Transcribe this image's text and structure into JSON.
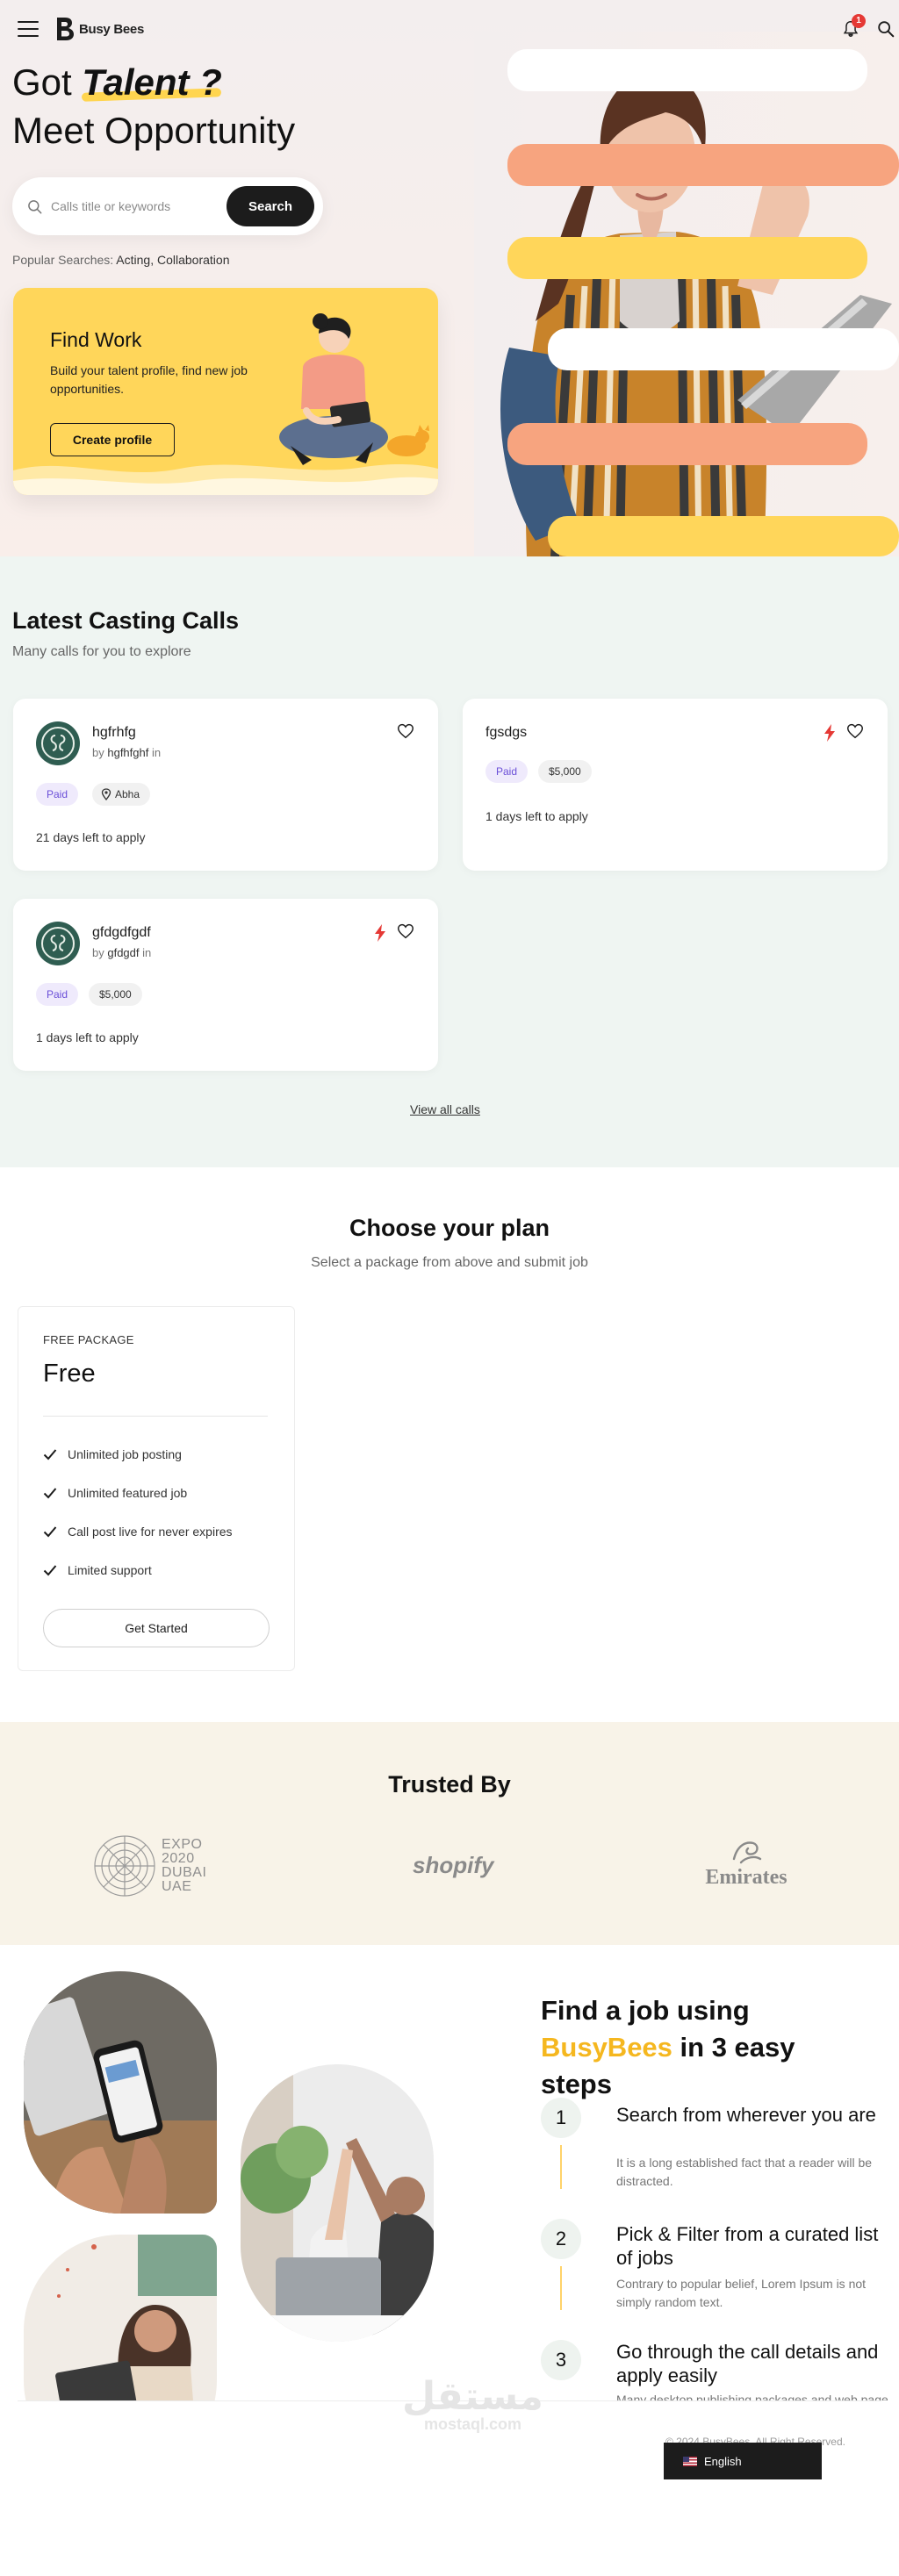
{
  "brand": {
    "name": "Busy Bees"
  },
  "header": {
    "notification_count": "1"
  },
  "hero": {
    "title_prefix": "Got ",
    "title_highlight": "Talent ?",
    "title_line2": "Meet Opportunity",
    "search_placeholder": "Calls title or keywords",
    "search_button": "Search",
    "popular_label": "Popular Searches: ",
    "popular_tags": "Acting, Collaboration"
  },
  "find_work": {
    "title": "Find Work",
    "description": "Build your talent profile, find new job opportunities.",
    "button": "Create profile"
  },
  "casting": {
    "title": "Latest Casting Calls",
    "subtitle": "Many calls for you to explore",
    "view_all": "View all calls",
    "cards": [
      {
        "title": "hgfrhfg",
        "by_prefix": "by",
        "by_name": "hgfhfghf",
        "by_suffix": "in",
        "tag1": "Paid",
        "tag2": "Abha",
        "deadline_num": "21",
        "deadline_text": " days left to apply"
      },
      {
        "title": "fgsdgs",
        "tag1": "Paid",
        "tag2": "$5,000",
        "deadline_num": "1",
        "deadline_text": " days left to apply"
      },
      {
        "title": "gfdgdfgdf",
        "by_prefix": "by",
        "by_name": "gfdgdf",
        "by_suffix": "in",
        "tag1": "Paid",
        "tag2": "$5,000",
        "deadline_num": "1",
        "deadline_text": " days left to apply"
      }
    ]
  },
  "plans": {
    "title": "Choose your plan",
    "subtitle": "Select a package from above and submit job",
    "package": {
      "tag": "FREE PACKAGE",
      "name": "Free",
      "features": [
        "Unlimited job posting",
        "Unlimited featured job",
        "Call post live for never expires",
        "Limited support"
      ],
      "button": "Get Started"
    }
  },
  "trusted": {
    "title": "Trusted By",
    "logos": {
      "expo_line1": "EXPO",
      "expo_line2": "2020",
      "expo_line3": "DUBAI",
      "expo_line4": "UAE",
      "shopify": "shopify",
      "emirates": "Emirates"
    }
  },
  "steps": {
    "title_line1": "Find a job using",
    "title_brand": "BusyBees",
    "title_line2_rest": " in 3 easy",
    "title_line3": "steps",
    "items": [
      {
        "num": "1",
        "head": "Search from  wherever  you are",
        "desc": "It is a long established fact that a reader will be distracted."
      },
      {
        "num": "2",
        "head": "Pick & Filter from a  curated list  of jobs",
        "desc": "Contrary to popular belief, Lorem Ipsum is not simply random text."
      },
      {
        "num": "3",
        "head": "Go through the call details and  apply easily",
        "desc": "Many desktop publishing packages and web page editors."
      }
    ]
  },
  "footer": {
    "watermark_ar": "مستقل",
    "watermark_en": "mostaql.com",
    "copyright": "© 2024 BusyBees. All Right Reserved.",
    "language": "English"
  },
  "colors": {
    "accent_yellow": "#ffd65a",
    "accent_salmon": "#f7a47f",
    "dark": "#1c1c1c",
    "paid_chip": "#6b4fd8",
    "brand_word": "#f5b71f"
  }
}
